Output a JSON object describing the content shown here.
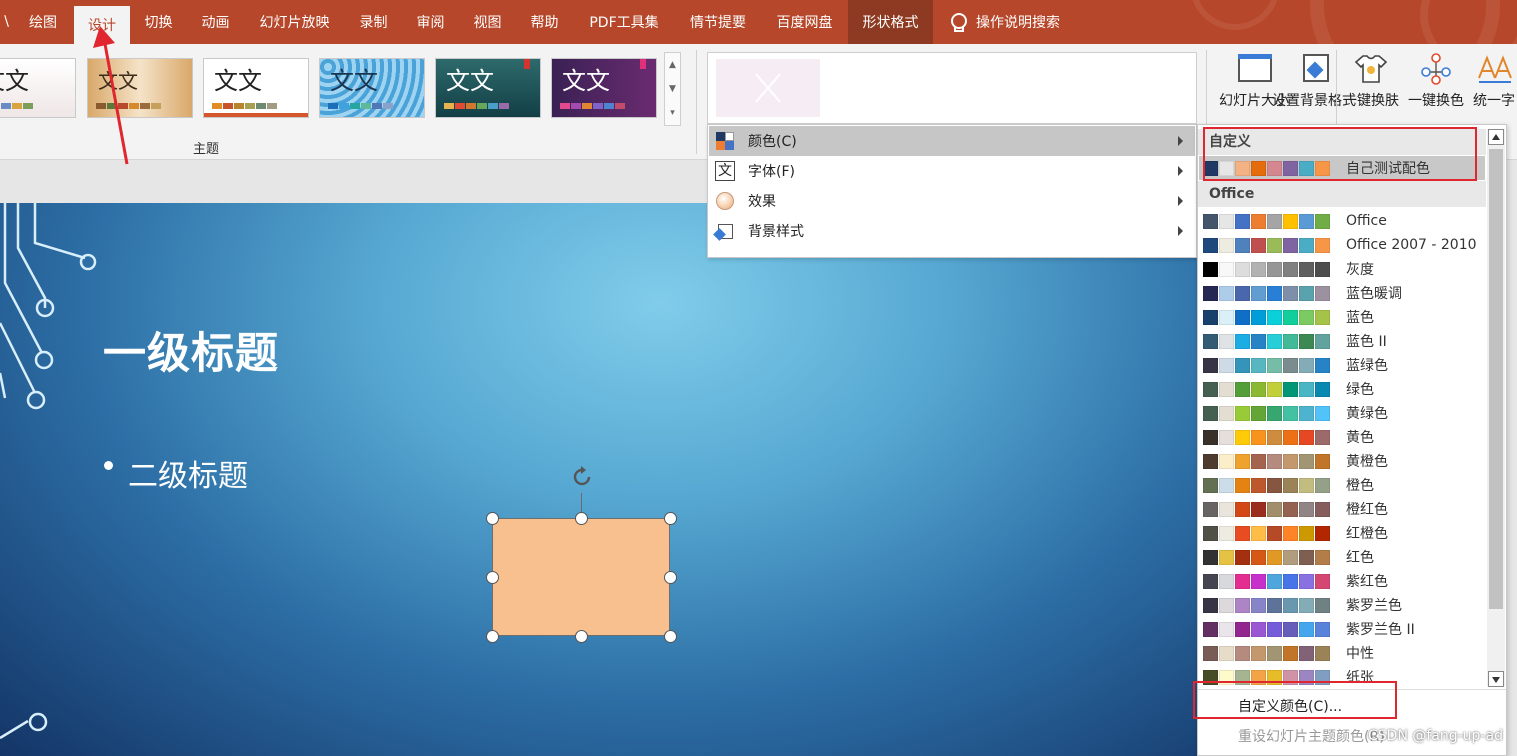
{
  "ribbon_tabs": [
    "绘图",
    "设计",
    "切换",
    "动画",
    "幻灯片放映",
    "录制",
    "审阅",
    "视图",
    "帮助",
    "PDF工具集",
    "情节提要",
    "百度网盘",
    "形状格式"
  ],
  "tell_me": "操作说明搜索",
  "themes": {
    "sample_text": "文文",
    "group_label": "主题"
  },
  "design_buttons": {
    "slide_size": "幻灯片大小",
    "format_background": "设置背景格式",
    "one_click_skin": "一键换肤",
    "one_click_color": "一键换色",
    "unify_font": "统一字"
  },
  "slide": {
    "title": "一级标题",
    "subtitle": "二级标题"
  },
  "variant_menu": {
    "items": [
      {
        "label": "颜色(C)",
        "icon": "color-palette-icon"
      },
      {
        "label": "字体(F)",
        "icon": "font-icon"
      },
      {
        "label": "效果",
        "icon": "effects-icon"
      },
      {
        "label": "背景样式",
        "icon": "background-style-icon"
      }
    ]
  },
  "color_menu": {
    "custom_header": "自定义",
    "custom_schemes": [
      {
        "name": "自己测试配色",
        "colors": [
          "#1f3864",
          "#e7e6e6",
          "#f4b183",
          "#e46c0a",
          "#d4878f",
          "#8064a2",
          "#4bacc6",
          "#f79646"
        ]
      }
    ],
    "office_header": "Office",
    "office_schemes": [
      {
        "name": "Office",
        "colors": [
          "#44546a",
          "#e7e6e6",
          "#4472c4",
          "#ed7d31",
          "#a5a5a5",
          "#ffc000",
          "#5b9bd5",
          "#70ad47"
        ]
      },
      {
        "name": "Office 2007 - 2010",
        "colors": [
          "#1f497d",
          "#eeece1",
          "#4f81bd",
          "#c0504d",
          "#9bbb59",
          "#8064a2",
          "#4bacc6",
          "#f79646"
        ]
      },
      {
        "name": "灰度",
        "colors": [
          "#000000",
          "#f8f8f8",
          "#dddddd",
          "#b2b2b2",
          "#969696",
          "#808080",
          "#5f5f5f",
          "#4d4d4d"
        ]
      },
      {
        "name": "蓝色暖调",
        "colors": [
          "#242852",
          "#acccea",
          "#4a66ac",
          "#629dd1",
          "#297fd5",
          "#7f8fa9",
          "#5aa2ae",
          "#9d90a0"
        ]
      },
      {
        "name": "蓝色",
        "colors": [
          "#17406d",
          "#dbeff9",
          "#0f6fc6",
          "#009dd9",
          "#0bd0d9",
          "#10cf9b",
          "#7cca62",
          "#a5c249"
        ]
      },
      {
        "name": "蓝色 II",
        "colors": [
          "#335b74",
          "#dfe3e5",
          "#1cade4",
          "#2683c6",
          "#27ced7",
          "#42ba97",
          "#3e8853",
          "#62a39f"
        ]
      },
      {
        "name": "蓝绿色",
        "colors": [
          "#373545",
          "#cedbe6",
          "#3494ba",
          "#58b6c0",
          "#75bda7",
          "#7a8c8e",
          "#84acb6",
          "#2683c6"
        ]
      },
      {
        "name": "绿色",
        "colors": [
          "#455f51",
          "#e3ded1",
          "#549e39",
          "#8ab833",
          "#c0cf3a",
          "#029676",
          "#4ab5c4",
          "#0989b1"
        ]
      },
      {
        "name": "黄绿色",
        "colors": [
          "#455f51",
          "#e3ded1",
          "#99cb38",
          "#63a537",
          "#37a76f",
          "#44c1a3",
          "#4eb3cf",
          "#51c3f9"
        ]
      },
      {
        "name": "黄色",
        "colors": [
          "#39302a",
          "#e5dedb",
          "#ffca08",
          "#f8931d",
          "#ce8d3e",
          "#ec7016",
          "#e64823",
          "#9c6a6a"
        ]
      },
      {
        "name": "黄橙色",
        "colors": [
          "#4e3b30",
          "#fbeec9",
          "#f0a22e",
          "#a5644e",
          "#b58b80",
          "#c3986d",
          "#a19574",
          "#c17529"
        ]
      },
      {
        "name": "橙色",
        "colors": [
          "#637052",
          "#ccddea",
          "#e48312",
          "#bd582c",
          "#865640",
          "#9b8357",
          "#c2bc80",
          "#94a088"
        ]
      },
      {
        "name": "橙红色",
        "colors": [
          "#696464",
          "#e9e5dc",
          "#d34817",
          "#9b2d1f",
          "#a28e6a",
          "#956251",
          "#918485",
          "#855d5d"
        ]
      },
      {
        "name": "红橙色",
        "colors": [
          "#505046",
          "#eeece1",
          "#e84c22",
          "#ffbd47",
          "#b64926",
          "#ff8427",
          "#cc9900",
          "#b22600"
        ]
      },
      {
        "name": "红色",
        "colors": [
          "#323232",
          "#e5c243",
          "#a5300f",
          "#d55816",
          "#e19825",
          "#b19c7d",
          "#7f5f52",
          "#b27d49"
        ]
      },
      {
        "name": "紫红色",
        "colors": [
          "#454551",
          "#d8d9dc",
          "#e32d91",
          "#c830cc",
          "#4ea6dc",
          "#4775e7",
          "#8971e1",
          "#d54773"
        ]
      },
      {
        "name": "紫罗兰色",
        "colors": [
          "#373545",
          "#dcd8dc",
          "#ad84c6",
          "#8784c7",
          "#5d739a",
          "#6997af",
          "#84acb6",
          "#6f8183"
        ]
      },
      {
        "name": "紫罗兰色 II",
        "colors": [
          "#632e62",
          "#eae5eb",
          "#92278f",
          "#9b57d3",
          "#755dd9",
          "#665eb8",
          "#45a5ed",
          "#5982db"
        ]
      },
      {
        "name": "中性",
        "colors": [
          "#7a5c56",
          "#e6dcc8",
          "#b58b80",
          "#c3986d",
          "#a19574",
          "#c17529",
          "#826277",
          "#9b8357"
        ]
      },
      {
        "name": "纸张",
        "colors": [
          "#444d26",
          "#fefac9",
          "#a5b592",
          "#f3a447",
          "#e7bc29",
          "#d092a7",
          "#9c85c0",
          "#809ec2"
        ]
      }
    ],
    "custom_colors": "自定义颜色(C)...",
    "reset_colors": "重设幻灯片主题颜色(R)"
  },
  "watermark": "CSDN @fang-up-ad"
}
